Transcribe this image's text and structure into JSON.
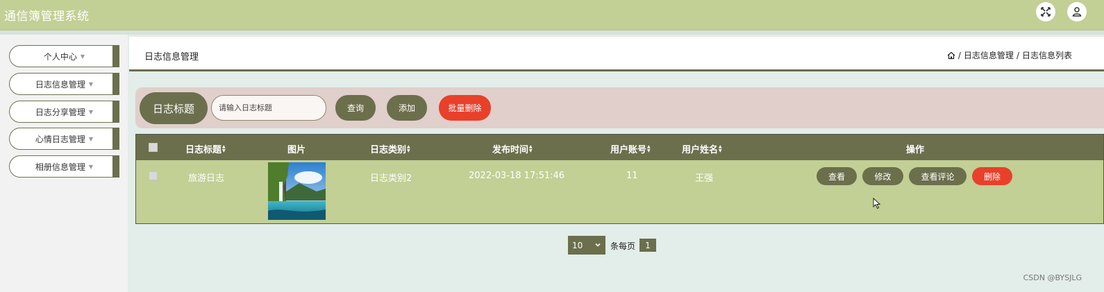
{
  "app": {
    "title": "通信簿管理系统"
  },
  "header_icons": [
    "fullscreen-icon",
    "user-icon"
  ],
  "sidebar": {
    "items": [
      {
        "label": "个人中心"
      },
      {
        "label": "日志信息管理"
      },
      {
        "label": "日志分享管理"
      },
      {
        "label": "心情日志管理"
      },
      {
        "label": "相册信息管理"
      }
    ]
  },
  "main": {
    "title": "日志信息管理",
    "breadcrumb": [
      "日志信息管理",
      "日志信息列表"
    ],
    "breadcrumb_sep": "/"
  },
  "search": {
    "label": "日志标题",
    "placeholder": "请输入日志标题",
    "value": "",
    "query_label": "查询",
    "add_label": "添加",
    "batch_delete_label": "批量删除"
  },
  "table": {
    "columns": [
      "日志标题",
      "图片",
      "日志类别",
      "发布时间",
      "用户账号",
      "用户姓名",
      "操作"
    ],
    "rows": [
      {
        "title": "旅游日志",
        "category": "日志类别2",
        "time": "2022-03-18 17:51:46",
        "account": "11",
        "name": "王强",
        "actions": [
          "查看",
          "修改",
          "查看评论",
          "删除"
        ]
      }
    ]
  },
  "pagination": {
    "page_size": "10",
    "per_page_label": "条每页",
    "current_page": "1"
  },
  "watermark": "CSDN @BYSJLG",
  "colors": {
    "header": "#c2cf95",
    "accent": "#6b6f4c",
    "danger": "#e8402a",
    "search_bg": "#e0cfcb"
  }
}
